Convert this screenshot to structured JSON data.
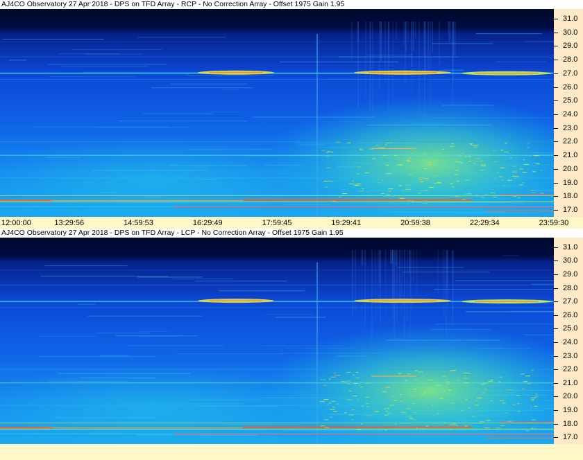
{
  "panels": [
    {
      "title": "AJ4CO Observatory 27 Apr 2018 - DPS on TFD Array  - RCP  -  No Correction Array  -  Offset 1975  Gain 1.95",
      "polarization": "RCP"
    },
    {
      "title": "AJ4CO Observatory 27 Apr 2018 - DPS on TFD Array  - LCP  -  No Correction Array  -  Offset 1975  Gain 1.95",
      "polarization": "LCP"
    }
  ],
  "time_labels": [
    "12:00:00",
    "13:29:56",
    "14:59:53",
    "16:29:49",
    "17:59:45",
    "19:29:41",
    "20:59:38",
    "22:29:34",
    "23:59:30"
  ],
  "freq_labels": [
    "31.0",
    "30.0",
    "29.0",
    "28.0",
    "27.0",
    "26.0",
    "25.0",
    "24.0",
    "23.0",
    "22.0",
    "21.0",
    "20.0",
    "19.0",
    "18.0",
    "17.0"
  ],
  "chart_data": {
    "type": "heatmap",
    "x_ticks": [
      "12:00:00",
      "13:29:56",
      "14:59:53",
      "16:29:49",
      "17:59:45",
      "19:29:41",
      "20:59:38",
      "22:29:34",
      "23:59:30"
    ],
    "y_ticks": [
      31.0,
      30.0,
      29.0,
      28.0,
      27.0,
      26.0,
      25.0,
      24.0,
      23.0,
      22.0,
      21.0,
      20.0,
      19.0,
      18.0,
      17.0
    ],
    "ylim": [
      16.5,
      31.7
    ],
    "colors": {
      "low": "#000a2e",
      "mid_low": "#0a3cd8",
      "mid": "#1e8cf0",
      "mid_high": "#28d2dc",
      "high": "#b4f05a",
      "peak": "#ff5a28",
      "axis_bg": "#ffe9c6",
      "xaxis_bg": "#fff7c8"
    }
  }
}
